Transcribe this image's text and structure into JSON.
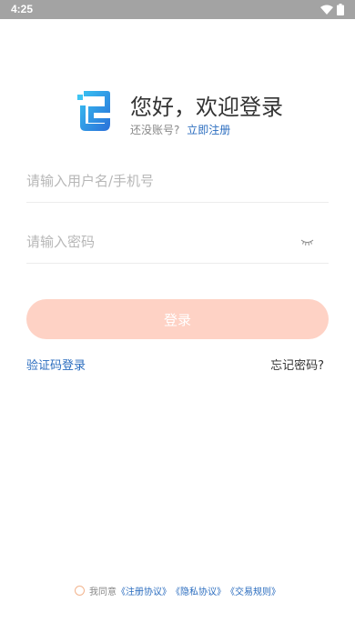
{
  "status_bar": {
    "time": "4:25"
  },
  "header": {
    "title": "您好，欢迎登录",
    "subtitle": "还没账号?",
    "register_link": "立即注册"
  },
  "form": {
    "username_placeholder": "请输入用户名/手机号",
    "password_placeholder": "请输入密码",
    "login_button": "登录"
  },
  "links": {
    "sms_login": "验证码登录",
    "forgot_password": "忘记密码?"
  },
  "agreement": {
    "prefix": "我同意",
    "terms": "《注册协议》",
    "privacy": "《隐私协议》",
    "trade_rules": "《交易规则》"
  },
  "colors": {
    "accent_blue": "#2b6dbf",
    "login_button": "#fed2c5",
    "status_bar": "#a3a3a3"
  },
  "icons": {
    "logo": "brand-logo-icon",
    "password_visibility": "eye-closed-icon",
    "wifi": "wifi-icon",
    "battery": "battery-icon"
  }
}
